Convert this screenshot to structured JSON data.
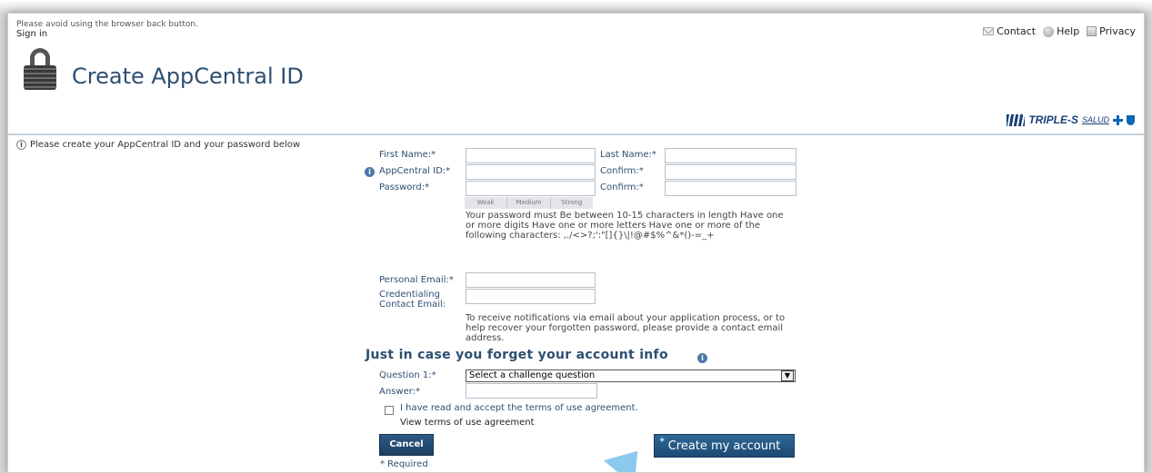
{
  "header": {
    "back_note": "Please avoid using the browser back button.",
    "sign_in": "Sign in",
    "links": {
      "contact": "Contact",
      "help": "Help",
      "privacy": "Privacy"
    },
    "title": "Create AppCentral ID",
    "brand": {
      "name": "TRIPLE-S",
      "sub": "SALUD"
    }
  },
  "intro": "Please create your AppCentral ID and your password below",
  "form": {
    "first_name": {
      "label": "First Name:*",
      "value": ""
    },
    "last_name": {
      "label": "Last Name:*",
      "value": ""
    },
    "appcentral_id": {
      "label": "AppCentral ID:*",
      "value": ""
    },
    "confirm_id": {
      "label": "Confirm:*",
      "value": ""
    },
    "password": {
      "label": "Password:*",
      "value": ""
    },
    "confirm_password": {
      "label": "Confirm:*",
      "value": ""
    },
    "strength": [
      "Weak",
      "Medium",
      "Strong"
    ],
    "password_rules": "Your password must Be between 10-15 characters in length Have one or more digits Have one or more letters Have one or more of the following characters: ,./<>?;':\"[]{}\\|!@#$%^&*()-=_+",
    "personal_email": {
      "label": "Personal Email:*",
      "value": ""
    },
    "credentialing_email": {
      "label_line1": "Credentialing",
      "label_line2": "Contact Email:",
      "value": ""
    },
    "email_note": "To receive notifications via email about your application process, or to help recover your forgotten password, please provide a contact email address."
  },
  "recovery": {
    "heading": "Just in case you forget your account info",
    "question_label": "Question 1:*",
    "question_value": "Select a challenge question",
    "answer_label": "Answer:*",
    "answer_value": ""
  },
  "terms": {
    "accept_label": "I have read and accept the terms of use agreement.",
    "view_link": "View terms of use agreement"
  },
  "actions": {
    "cancel": "Cancel",
    "create": "Create my account",
    "required_note": "* Required"
  }
}
